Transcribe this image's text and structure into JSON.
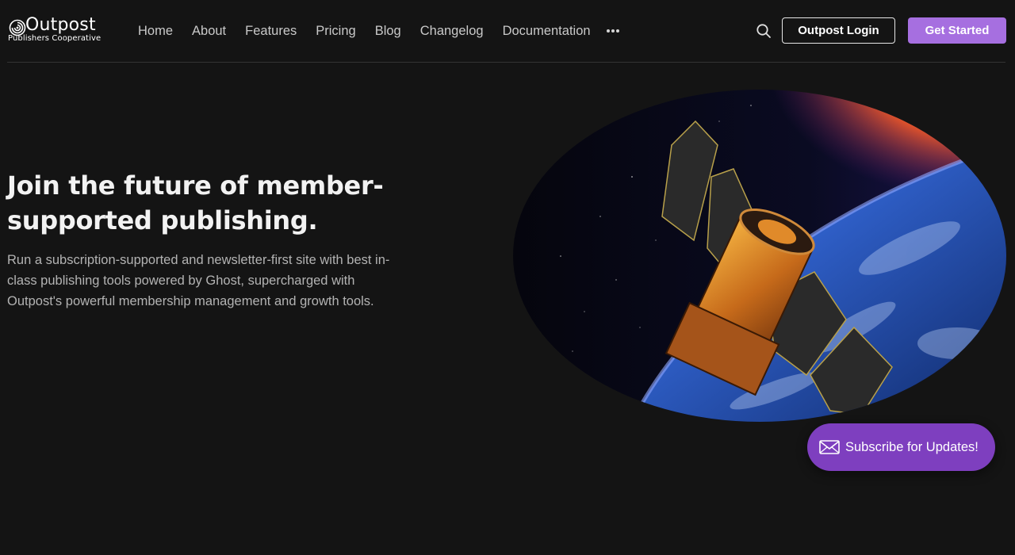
{
  "brand": {
    "name": "Outpost",
    "tagline": "Publishers Cooperative",
    "logo_icon": "spiral-logo-icon"
  },
  "nav": {
    "items": [
      {
        "label": "Home"
      },
      {
        "label": "About"
      },
      {
        "label": "Features"
      },
      {
        "label": "Pricing"
      },
      {
        "label": "Blog"
      },
      {
        "label": "Changelog"
      },
      {
        "label": "Documentation"
      }
    ],
    "more_icon": "ellipsis-icon"
  },
  "header_actions": {
    "search_icon": "search-icon",
    "login_label": "Outpost Login",
    "cta_label": "Get Started"
  },
  "hero": {
    "title": "Join the future of member-supported publishing.",
    "body": "Run a subscription-supported and newsletter-first site with best in-class publishing tools powered by Ghost, supercharged with Outpost's powerful membership management and growth tools.",
    "image": "satellite-orbiting-earth-illustration"
  },
  "subscribe": {
    "label": "Subscribe for Updates!",
    "icon": "envelope-icon"
  },
  "colors": {
    "background": "#141414",
    "accent": "#a66fe0",
    "subscribe_bg": "#7e3fbf",
    "nav_text": "#c9c9c9",
    "body_text": "#b3b3b3"
  }
}
